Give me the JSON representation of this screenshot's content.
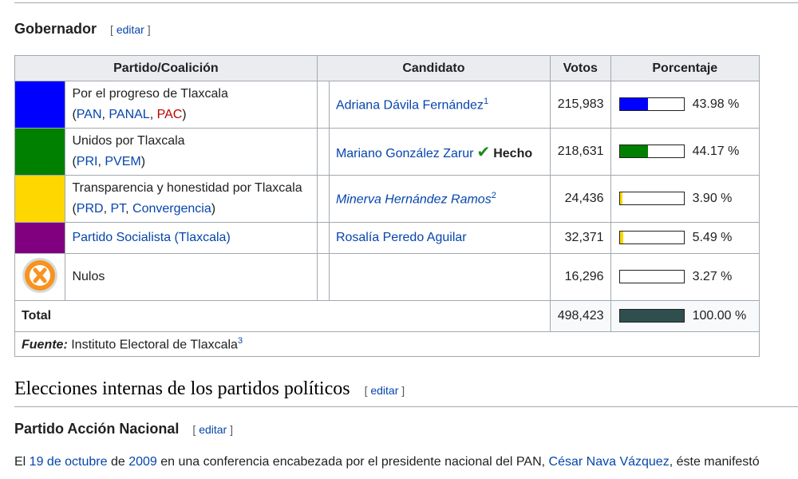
{
  "governor": {
    "heading": "Gobernador",
    "edit_prefix": "[",
    "edit_label": "editar",
    "edit_suffix": "]"
  },
  "table": {
    "headers": {
      "party": "Partido/Coalición",
      "candidate": "Candidato",
      "votes": "Votos",
      "percentage": "Porcentaje"
    },
    "rows": [
      {
        "color": "#0000ff",
        "party_name": "Por el progreso de Tlaxcala",
        "parties": [
          "PAN",
          "PANAL",
          "PAC"
        ],
        "candidate": "Adriana Dávila Fernández",
        "candidate_note": "1",
        "votes": "215,983",
        "percentage": "43.98 %",
        "share": 0.4398,
        "bar_color": "#0000ff"
      },
      {
        "color": "#008000",
        "party_name": "Unidos por Tlaxcala",
        "parties": [
          "PRI",
          "PVEM"
        ],
        "candidate": "Mariano González Zarur",
        "winner_mark": "✔",
        "winner_label": "Hecho",
        "votes": "218,631",
        "percentage": "44.17 %",
        "share": 0.4417,
        "bar_color": "#008000"
      },
      {
        "color": "#ffd700",
        "party_name": "Transparencia y honestidad por Tlaxcala",
        "parties": [
          "PRD",
          "PT",
          "Convergencia"
        ],
        "candidate": "Minerva Hernández Ramos",
        "candidate_note": "2",
        "votes": "24,436",
        "percentage": "3.90 %",
        "share": 0.039,
        "bar_color": "#ffd700"
      },
      {
        "color": "#800080",
        "party_name": "Partido Socialista (Tlaxcala)",
        "candidate": "Rosalía Peredo Aguilar",
        "votes": "32,371",
        "percentage": "5.49 %",
        "share": 0.0549,
        "bar_color": "#ffd700"
      },
      {
        "icon": "null-vote-icon",
        "party_name": "Nulos",
        "votes": "16,296",
        "percentage": "3.27 %",
        "share": 0.0327,
        "bar_color": "#ffffff"
      }
    ],
    "total": {
      "label": "Total",
      "votes": "498,423",
      "percentage": "100.00 %",
      "share": 1.0,
      "bar_color": "#2f4f4f"
    },
    "source": {
      "label": "Fuente:",
      "text": "Instituto Electoral de Tlaxcala",
      "note": "3"
    }
  },
  "section": {
    "heading": "Elecciones internas de los partidos políticos",
    "edit_label": "editar"
  },
  "pan": {
    "heading": "Partido Acción Nacional",
    "edit_label": "editar"
  },
  "paragraph": {
    "part1": "El ",
    "link1": "19 de octubre",
    "part2": " de ",
    "link2": "2009",
    "part3": " en una conferencia encabezada por el presidente nacional del PAN, ",
    "link3": "César Nava Vázquez",
    "part4": ", éste manifestó"
  },
  "colors": {
    "link": "#0645ad",
    "redlink": "#ba0000",
    "border": "#a2a9b1",
    "header_bg": "#eaecf0"
  }
}
